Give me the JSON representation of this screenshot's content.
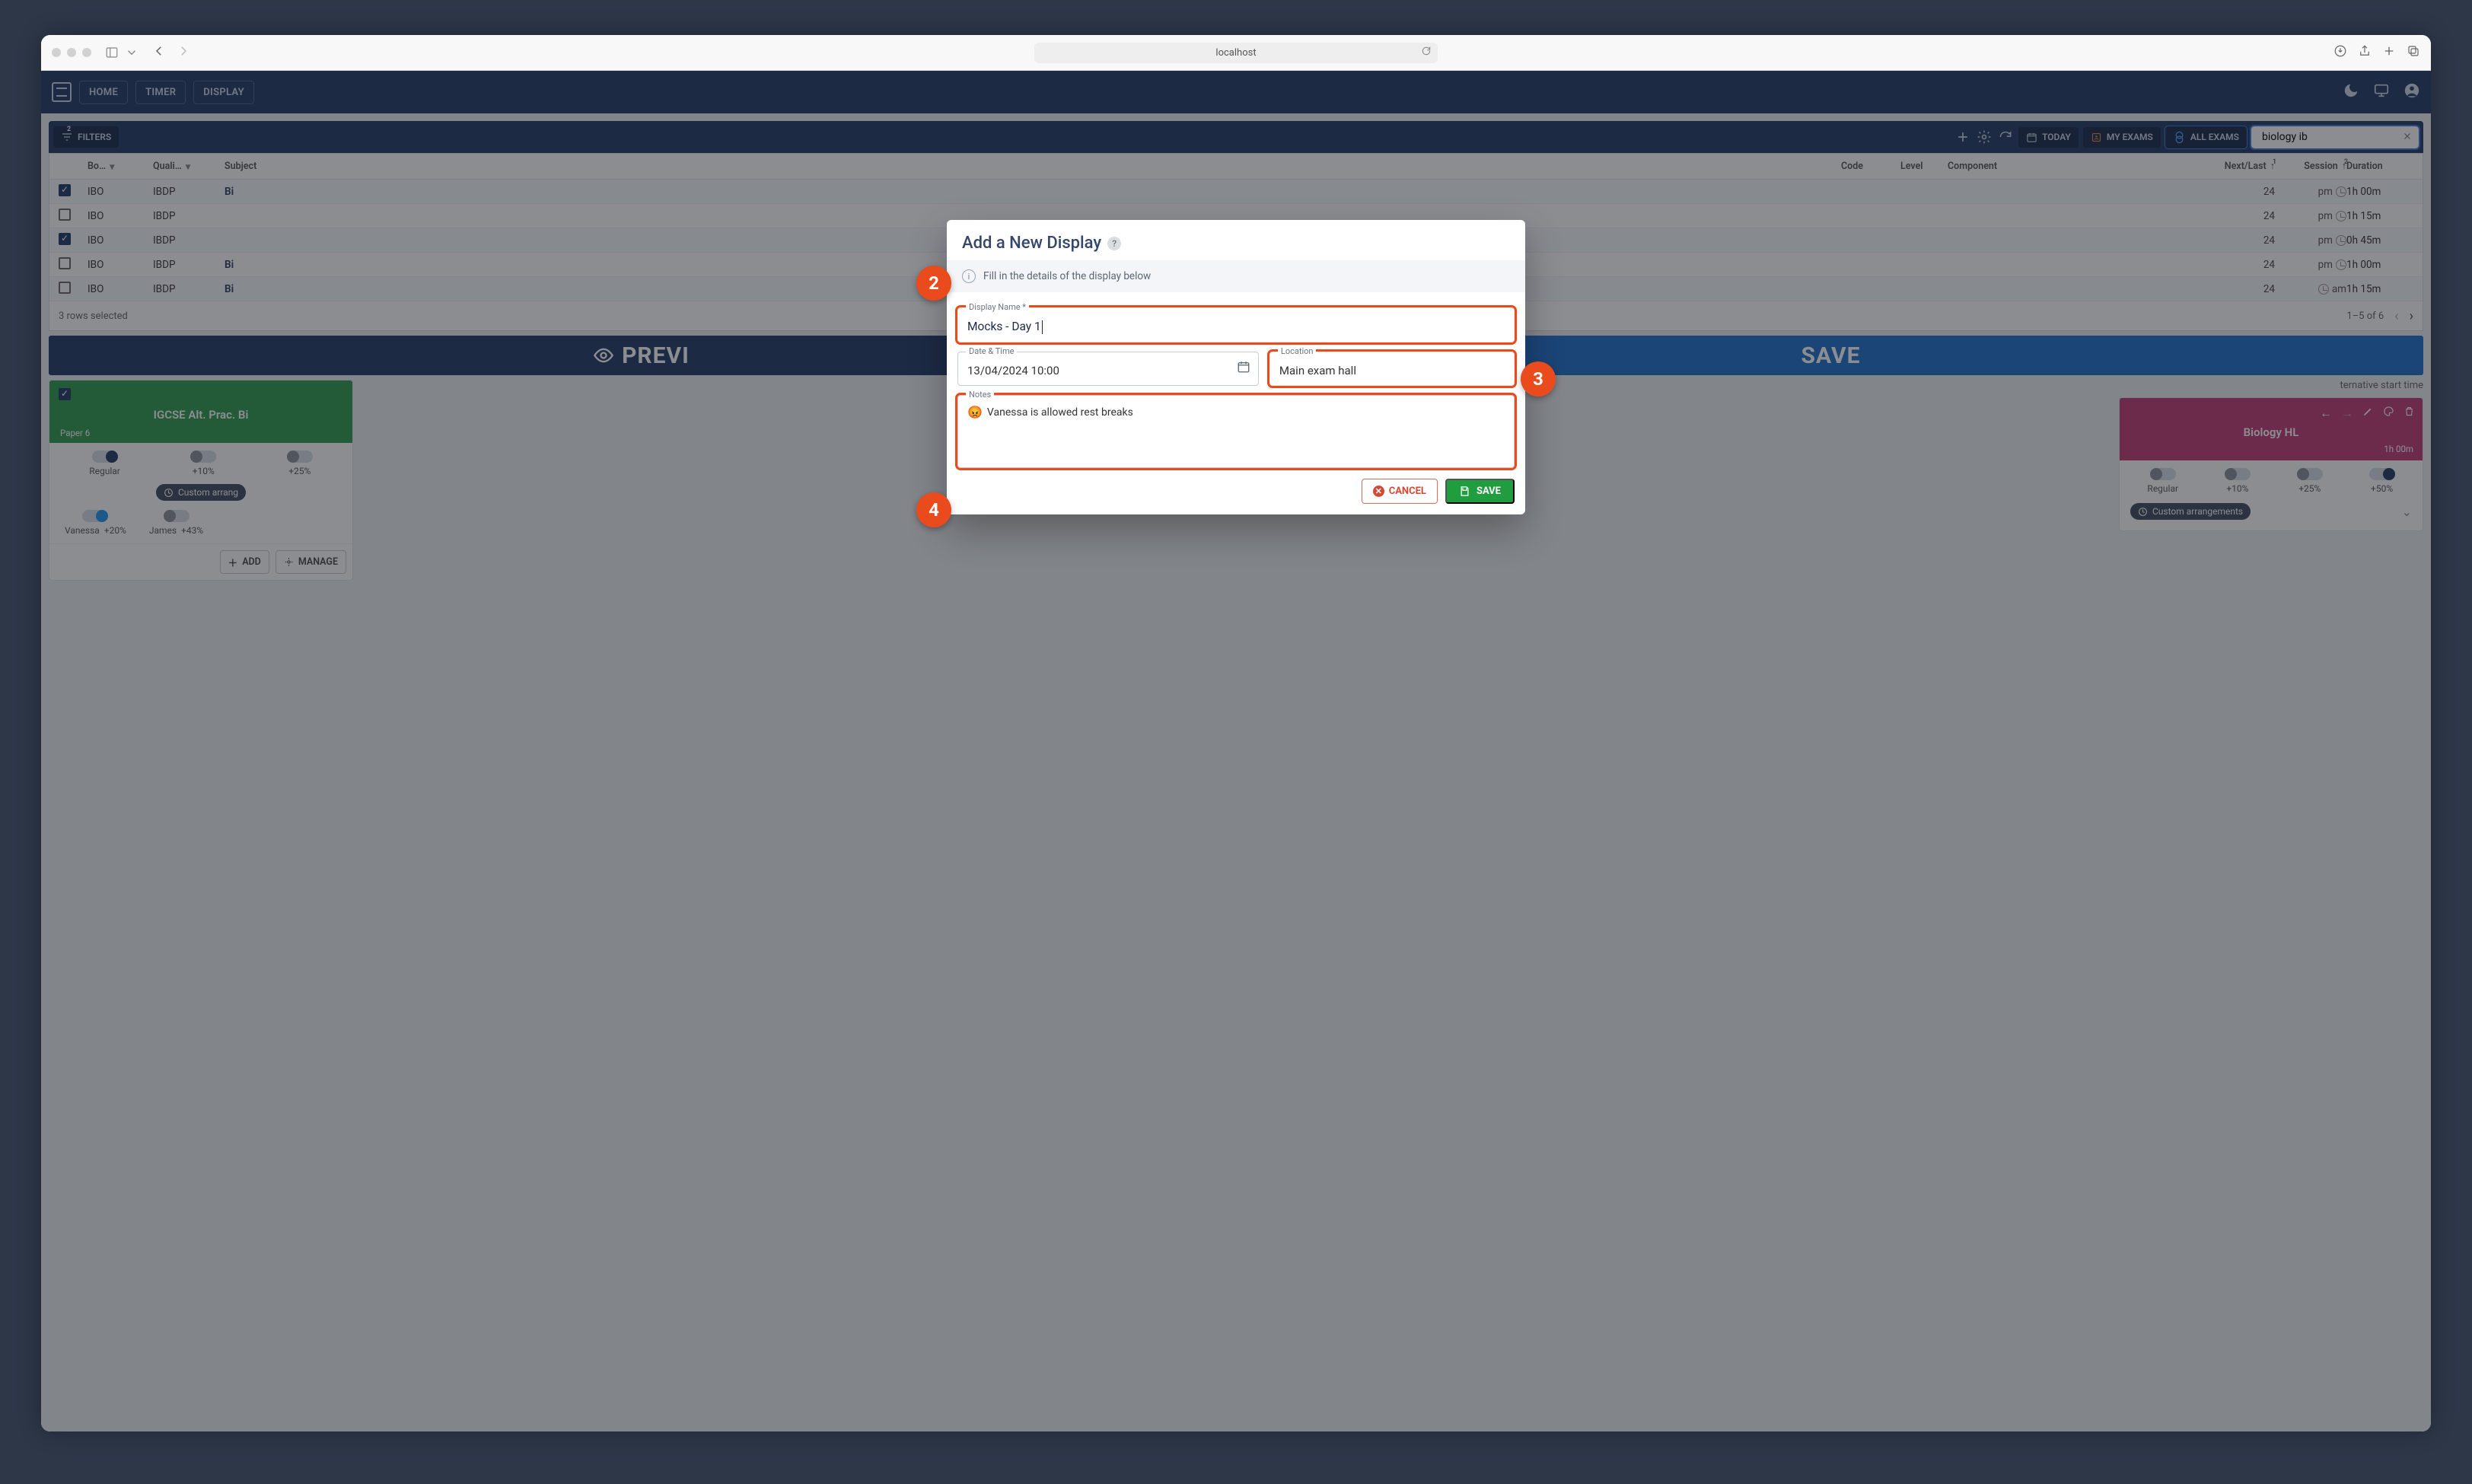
{
  "browser": {
    "url": "localhost"
  },
  "nav": {
    "home": "HOME",
    "timer": "TIMER",
    "display": "DISPLAY"
  },
  "toolbar": {
    "filters_label": "FILTERS",
    "filters_count": "2",
    "today": "TODAY",
    "my_exams": "MY EXAMS",
    "all_exams": "ALL EXAMS",
    "search_value": "biology ib"
  },
  "columns": {
    "board": "Bo…",
    "qual": "Quali…",
    "subject": "Subject",
    "code": "Code",
    "level": "Level",
    "component": "Component",
    "nextlast": "Next/Last",
    "nextlast_sup": "1",
    "session": "Session",
    "session_sup": "2",
    "duration": "Duration"
  },
  "rows": [
    {
      "checked": true,
      "board": "IBO",
      "qual": "IBDP",
      "subject": "Bi",
      "next": "24",
      "session": "pm",
      "duration": "1h 00m"
    },
    {
      "checked": false,
      "board": "IBO",
      "qual": "IBDP",
      "subject": "",
      "next": "24",
      "session": "pm",
      "duration": "1h 15m"
    },
    {
      "checked": true,
      "board": "IBO",
      "qual": "IBDP",
      "subject": "",
      "next": "24",
      "session": "pm",
      "duration": "0h 45m"
    },
    {
      "checked": false,
      "board": "IBO",
      "qual": "IBDP",
      "subject": "Bi",
      "next": "24",
      "session": "pm",
      "duration": "1h 00m"
    },
    {
      "checked": false,
      "board": "IBO",
      "qual": "IBDP",
      "subject": "Bi",
      "next": "24",
      "session": "am",
      "duration": "1h 15m"
    }
  ],
  "footer": {
    "selected": "3 rows selected",
    "range": "1–5 of 6"
  },
  "actionbar": {
    "preview": "PREVI",
    "save": "SAVE"
  },
  "info_strip": "ternative start time",
  "card_green": {
    "title": "IGCSE Alt. Prac. Bi",
    "paper": "Paper 6",
    "pills": [
      "Regular",
      "+10%",
      "+25%"
    ],
    "custom": "Custom arrang",
    "people": [
      {
        "name": "Vanessa",
        "pct": "+20%"
      },
      {
        "name": "James",
        "pct": "+43%"
      }
    ],
    "add": "ADD",
    "manage": "MANAGE"
  },
  "card_pink": {
    "title": "Biology HL",
    "duration": "1h 00m",
    "pills": [
      "Regular",
      "+10%",
      "+25%",
      "+50%"
    ],
    "custom": "Custom arrangements"
  },
  "center_chip": "Custom arrangements",
  "modal": {
    "title": "Add a New Display",
    "strip": "Fill in the details of the display below",
    "name_label": "Display Name *",
    "name_value": "Mocks - Day 1",
    "datetime_label": "Date & Time",
    "datetime_value": "13/04/2024 10:00",
    "location_label": "Location",
    "location_value": "Main exam hall",
    "notes_label": "Notes",
    "notes_value": "Vanessa is allowed rest breaks",
    "cancel": "CANCEL",
    "save": "SAVE"
  },
  "callouts": {
    "c2": "2",
    "c3": "3",
    "c4": "4"
  }
}
